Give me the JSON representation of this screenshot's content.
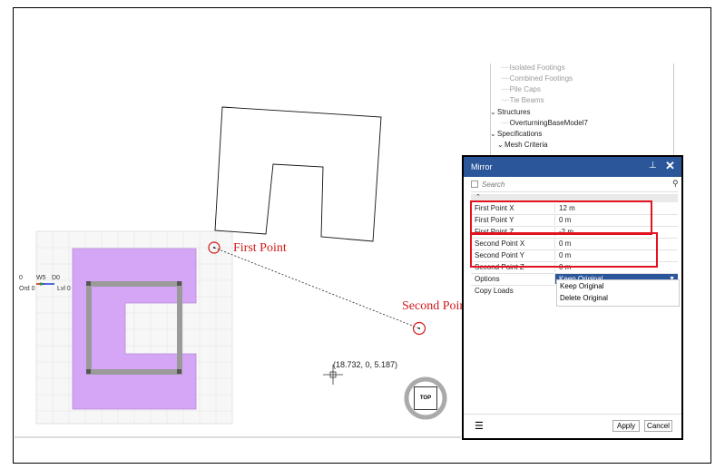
{
  "tree": {
    "items": [
      {
        "label": "Isolated Footings",
        "muted": true
      },
      {
        "label": "Combined Footings",
        "muted": true
      },
      {
        "label": "Pile Caps",
        "muted": true
      },
      {
        "label": "Tie Beams",
        "muted": true
      },
      {
        "label": "Structures",
        "muted": false
      },
      {
        "label": "OverturningBaseModel7",
        "muted": false
      },
      {
        "label": "Specifications",
        "muted": false
      },
      {
        "label": "Mesh Criteria",
        "muted": false
      }
    ]
  },
  "annotations": {
    "first_point": "First Point",
    "second_point": "Second Point",
    "cursor_coord": "(18.732, 0, 5.187)"
  },
  "axis_labels": {
    "a": "0",
    "b": "W5",
    "c": "D0",
    "ord": "Ord 0",
    "lvl": "Lvl 0"
  },
  "view_cube": {
    "label": "TOP"
  },
  "colors": {
    "panel_header": "#2b579a",
    "highlight_red": "#e3121f",
    "annotation_red": "#d01818",
    "footing_fill": "#d4a6f5",
    "beam_gray": "#9a9a9a"
  },
  "mirror_panel": {
    "title": "Mirror",
    "pin_icon": "pin-icon",
    "close_icon": "close-icon",
    "search": {
      "placeholder": "Search"
    },
    "properties": [
      {
        "label": "First Point X",
        "value": "12 m"
      },
      {
        "label": "First Point Y",
        "value": "0 m"
      },
      {
        "label": "First Point Z",
        "value": "-2 m"
      },
      {
        "label": "Second Point X",
        "value": "0 m"
      },
      {
        "label": "Second Point Y",
        "value": "0 m"
      },
      {
        "label": "Second Point Z",
        "value": "0 m"
      },
      {
        "label": "Options",
        "value": "Keep Original"
      },
      {
        "label": "Copy Loads",
        "value": ""
      }
    ],
    "options_dropdown": [
      "Keep Original",
      "Delete Original"
    ],
    "apply_label": "Apply",
    "cancel_label": "Cancel"
  }
}
